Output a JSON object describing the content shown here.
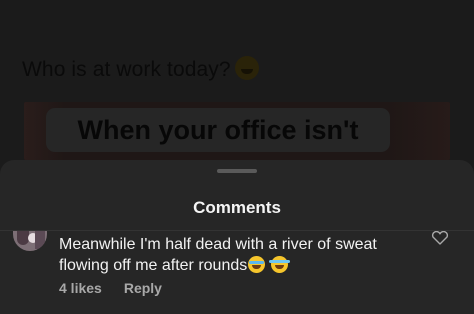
{
  "post": {
    "caption": "Who is at work today?",
    "caption_emoji": "dizzy-face-emoji",
    "media_text": "When your office isn't"
  },
  "sheet": {
    "title": "Comments"
  },
  "comment": {
    "text": "Meanwhile I'm half dead with a river of sweat flowing off me after rounds",
    "emojis": [
      "loudly-crying-face-emoji",
      "face-with-tears-of-joy-emoji"
    ],
    "likes": "4 likes",
    "reply_label": "Reply",
    "like_icon": "heart-outline-icon"
  },
  "colors": {
    "sheet_bg": "#262626",
    "text_primary": "#f2f2f2",
    "text_secondary": "#a8a8a8"
  }
}
